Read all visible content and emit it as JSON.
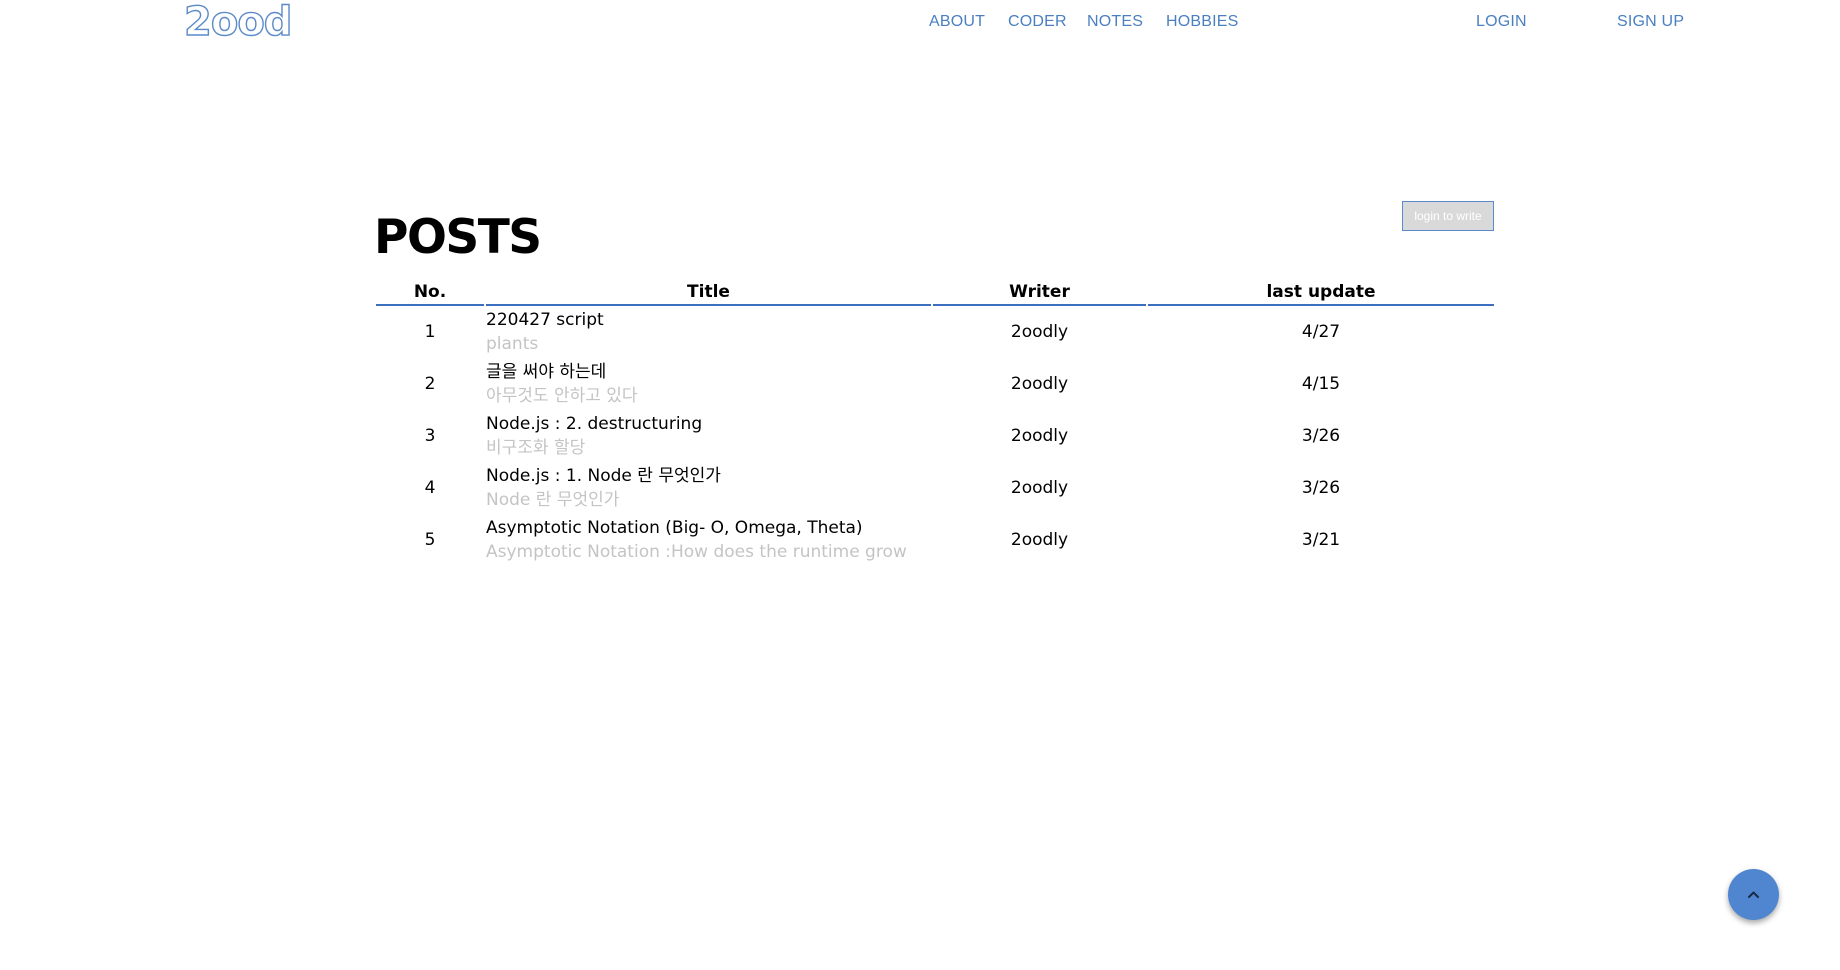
{
  "header": {
    "logo": "2ood",
    "nav": {
      "about": "ABOUT",
      "coder": "CODER",
      "notes": "NOTES",
      "hobbies": "HOBBIES"
    },
    "login": "LOGIN",
    "signup": "SIGN UP"
  },
  "posts": {
    "title": "POSTS",
    "write_button": "login to write",
    "columns": {
      "no": "No.",
      "title": "Title",
      "writer": "Writer",
      "last_update": "last update"
    },
    "rows": [
      {
        "no": "1",
        "title": "220427 script",
        "subtitle": "plants",
        "writer": "2oodly",
        "date": "4/27"
      },
      {
        "no": "2",
        "title": "글을 써야 하는데",
        "subtitle": "아무것도 안하고 있다",
        "writer": "2oodly",
        "date": "4/15"
      },
      {
        "no": "3",
        "title": "Node.js : 2. destructuring",
        "subtitle": "비구조화 할당",
        "writer": "2oodly",
        "date": "3/26"
      },
      {
        "no": "4",
        "title": "Node.js : 1. Node 란 무엇인가",
        "subtitle": "Node 란 무엇인가",
        "writer": "2oodly",
        "date": "3/26"
      },
      {
        "no": "5",
        "title": "Asymptotic Notation (Big- O, Omega, Theta)",
        "subtitle": "Asymptotic Notation :How does the runtime grow",
        "writer": "2oodly",
        "date": "3/21"
      }
    ]
  },
  "scroll_top": {
    "icon": "chevron-up-icon"
  },
  "colors": {
    "accent": "#4a7fc1",
    "table_rule": "#3d6fc0",
    "subtitle": "#c4c4c4",
    "fab": "#4f86cf"
  }
}
